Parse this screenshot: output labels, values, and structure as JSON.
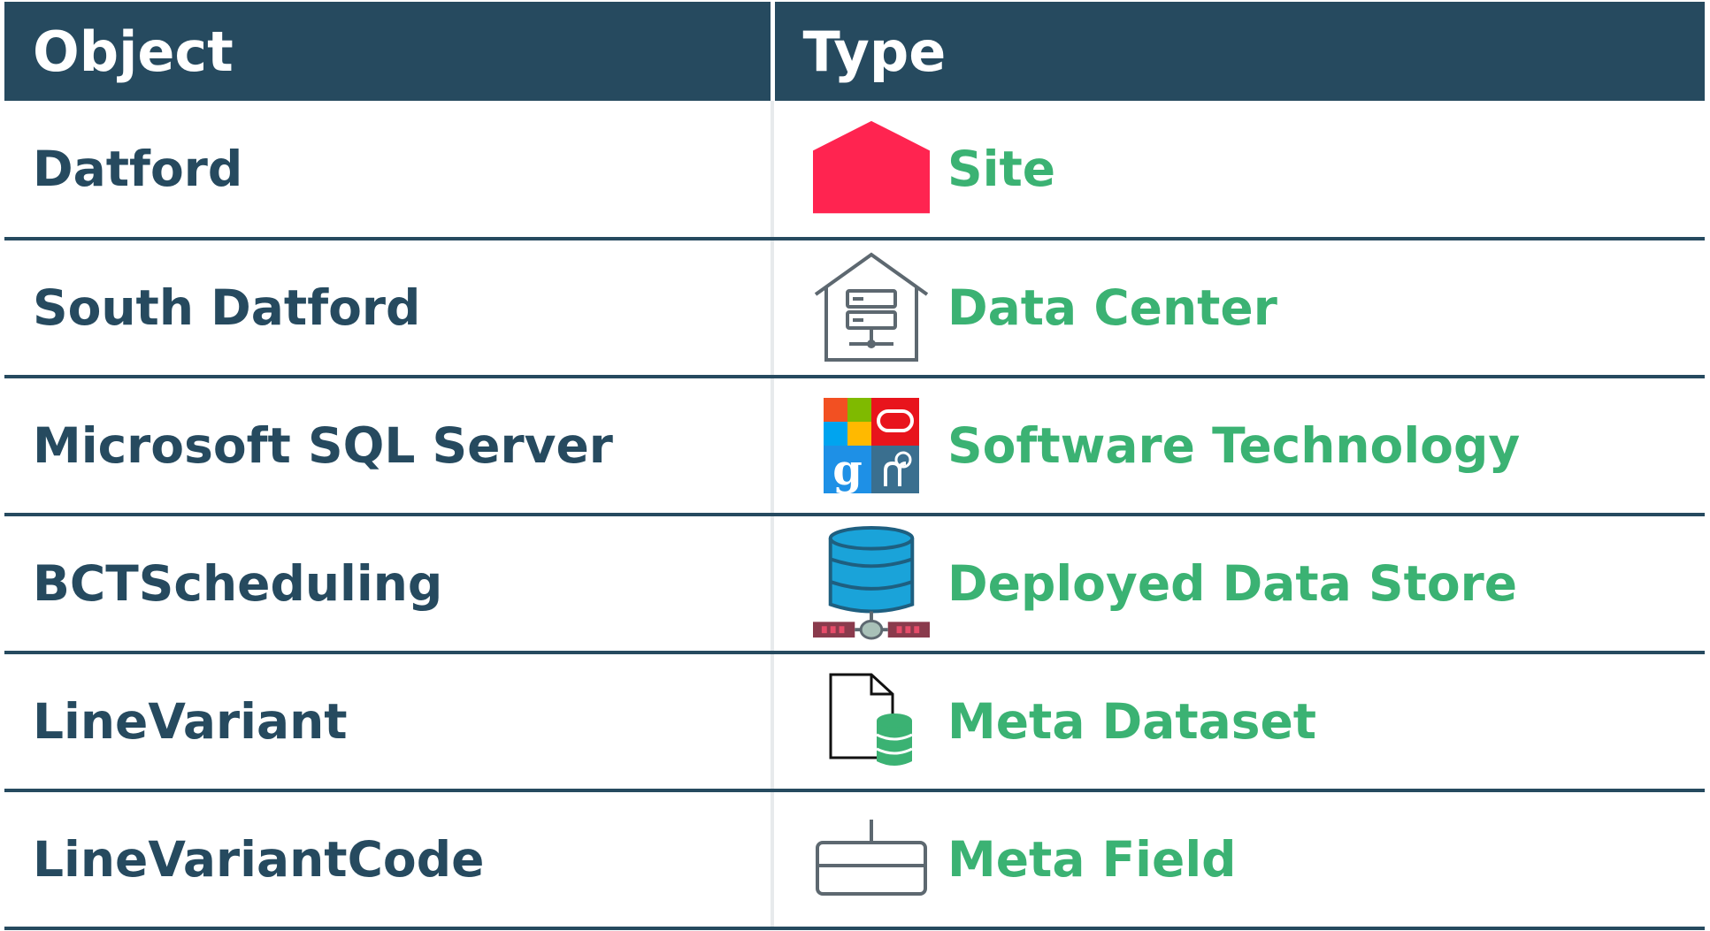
{
  "header": {
    "object_label": "Object",
    "type_label": "Type"
  },
  "rows": [
    {
      "object": "Datford",
      "type": "Site",
      "icon": "site-house-icon",
      "icon_color": "#ff2450"
    },
    {
      "object": "South Datford",
      "type": "Data Center",
      "icon": "data-center-icon",
      "icon_color": "#5d6870"
    },
    {
      "object": "Microsoft SQL Server",
      "type": "Software Technology",
      "icon": "software-technology-icon",
      "icon_color": "#f25022"
    },
    {
      "object": "BCTScheduling",
      "type": "Deployed Data Store",
      "icon": "database-icon",
      "icon_color": "#1aa3d9"
    },
    {
      "object": "LineVariant",
      "type": "Meta Dataset",
      "icon": "document-database-icon",
      "icon_color": "#3bb273"
    },
    {
      "object": "LineVariantCode",
      "type": "Meta Field",
      "icon": "meta-field-icon",
      "icon_color": "#5d6870"
    }
  ],
  "colors": {
    "header_bg": "#264a5f",
    "object_text": "#264a5f",
    "type_text": "#3bb273"
  }
}
